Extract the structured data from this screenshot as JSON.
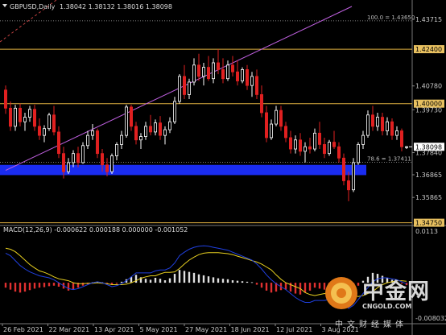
{
  "chart_data": [
    {
      "type": "candlestick",
      "symbol_header": "GBPUSD,Daily",
      "ohlc_header": "1.38042 1.38132 1.38016 1.38098",
      "ylim": [
        1.347,
        1.44
      ],
      "y_ticks": [
        1.43715,
        1.4224,
        1.4078,
        1.3973,
        1.3784,
        1.36865,
        1.35865,
        1.3475
      ],
      "y_tick_labels": [
        "1.43715",
        "1.42400",
        "1.40780",
        "1.39730",
        "1.37840",
        "1.36865",
        "1.35865",
        "1.34750"
      ],
      "x_labels": [
        "26 Feb 2021",
        "22 Mar 2021",
        "13 Apr 2021",
        "5 May 2021",
        "27 May 2021",
        "18 Jun 2021",
        "12 Jul 2021",
        "3 Aug 2021"
      ],
      "horizontal_levels": [
        {
          "value": 1.4365,
          "label": "100.0 = 1.43650",
          "style": "dotted",
          "color": "#aaaaaa"
        },
        {
          "value": 1.424,
          "label": "1.42400",
          "style": "solid",
          "color": "#e0b040"
        },
        {
          "value": 1.4,
          "label": "1.40000",
          "style": "solid",
          "color": "#e0b040"
        },
        {
          "value": 1.37411,
          "label": "78.6 = 1.37411",
          "style": "dotted",
          "color": "#aaaaaa"
        },
        {
          "value": 1.3475,
          "label": "1.34750",
          "style": "solid",
          "color": "#e0b040"
        }
      ],
      "current_price": {
        "value": 1.38098,
        "label": "1.38098"
      },
      "support_zone": {
        "low": 1.3685,
        "high": 1.373,
        "color": "#1a2cf0"
      },
      "candles": [
        [
          1.406,
          1.408,
          1.3955,
          1.398
        ],
        [
          1.398,
          1.401,
          1.388,
          1.39
        ],
        [
          1.39,
          1.3995,
          1.388,
          1.398
        ],
        [
          1.398,
          1.4,
          1.39,
          1.392
        ],
        [
          1.392,
          1.396,
          1.388,
          1.394
        ],
        [
          1.394,
          1.399,
          1.392,
          1.3975
        ],
        [
          1.3975,
          1.3995,
          1.388,
          1.39
        ],
        [
          1.39,
          1.3935,
          1.384,
          1.386
        ],
        [
          1.386,
          1.3905,
          1.383,
          1.389
        ],
        [
          1.389,
          1.396,
          1.388,
          1.395
        ],
        [
          1.395,
          1.399,
          1.386,
          1.3875
        ],
        [
          1.3875,
          1.39,
          1.376,
          1.378
        ],
        [
          1.378,
          1.381,
          1.367,
          1.37
        ],
        [
          1.37,
          1.376,
          1.369,
          1.374
        ],
        [
          1.374,
          1.3795,
          1.372,
          1.378
        ],
        [
          1.378,
          1.381,
          1.372,
          1.374
        ],
        [
          1.374,
          1.383,
          1.3735,
          1.3815
        ],
        [
          1.3815,
          1.388,
          1.38,
          1.386
        ],
        [
          1.386,
          1.391,
          1.384,
          1.388
        ],
        [
          1.388,
          1.389,
          1.376,
          1.378
        ],
        [
          1.378,
          1.38,
          1.37,
          1.373
        ],
        [
          1.373,
          1.376,
          1.368,
          1.37
        ],
        [
          1.37,
          1.378,
          1.369,
          1.377
        ],
        [
          1.377,
          1.383,
          1.375,
          1.382
        ],
        [
          1.382,
          1.388,
          1.38,
          1.386
        ],
        [
          1.386,
          1.3995,
          1.385,
          1.3985
        ],
        [
          1.3985,
          1.3995,
          1.388,
          1.39
        ],
        [
          1.39,
          1.392,
          1.382,
          1.384
        ],
        [
          1.384,
          1.387,
          1.38,
          1.3855
        ],
        [
          1.3855,
          1.392,
          1.384,
          1.39
        ],
        [
          1.39,
          1.395,
          1.386,
          1.3875
        ],
        [
          1.3875,
          1.393,
          1.386,
          1.3915
        ],
        [
          1.3915,
          1.3945,
          1.384,
          1.386
        ],
        [
          1.386,
          1.39,
          1.382,
          1.3885
        ],
        [
          1.3885,
          1.394,
          1.387,
          1.392
        ],
        [
          1.392,
          1.403,
          1.391,
          1.401
        ],
        [
          1.401,
          1.413,
          1.4,
          1.412
        ],
        [
          1.412,
          1.417,
          1.402,
          1.404
        ],
        [
          1.404,
          1.411,
          1.402,
          1.4095
        ],
        [
          1.4095,
          1.42,
          1.408,
          1.417
        ],
        [
          1.417,
          1.422,
          1.41,
          1.412
        ],
        [
          1.412,
          1.418,
          1.408,
          1.416
        ],
        [
          1.416,
          1.421,
          1.41,
          1.411
        ],
        [
          1.411,
          1.42,
          1.409,
          1.418
        ],
        [
          1.418,
          1.424,
          1.413,
          1.415
        ],
        [
          1.415,
          1.42,
          1.409,
          1.411
        ],
        [
          1.411,
          1.419,
          1.41,
          1.417
        ],
        [
          1.417,
          1.421,
          1.412,
          1.414
        ],
        [
          1.414,
          1.419,
          1.408,
          1.41
        ],
        [
          1.41,
          1.416,
          1.409,
          1.415
        ],
        [
          1.415,
          1.417,
          1.406,
          1.408
        ],
        [
          1.408,
          1.414,
          1.403,
          1.412
        ],
        [
          1.412,
          1.415,
          1.402,
          1.404
        ],
        [
          1.404,
          1.408,
          1.394,
          1.396
        ],
        [
          1.396,
          1.399,
          1.383,
          1.385
        ],
        [
          1.385,
          1.393,
          1.384,
          1.391
        ],
        [
          1.391,
          1.399,
          1.39,
          1.397
        ],
        [
          1.397,
          1.399,
          1.388,
          1.39
        ],
        [
          1.39,
          1.392,
          1.383,
          1.385
        ],
        [
          1.385,
          1.388,
          1.378,
          1.38
        ],
        [
          1.38,
          1.386,
          1.378,
          1.384
        ],
        [
          1.384,
          1.387,
          1.377,
          1.379
        ],
        [
          1.379,
          1.383,
          1.374,
          1.381
        ],
        [
          1.381,
          1.385,
          1.378,
          1.38
        ],
        [
          1.38,
          1.389,
          1.379,
          1.387
        ],
        [
          1.387,
          1.392,
          1.38,
          1.382
        ],
        [
          1.382,
          1.385,
          1.376,
          1.378
        ],
        [
          1.378,
          1.384,
          1.377,
          1.383
        ],
        [
          1.383,
          1.388,
          1.38,
          1.381
        ],
        [
          1.381,
          1.383,
          1.374,
          1.376
        ],
        [
          1.376,
          1.378,
          1.364,
          1.366
        ],
        [
          1.366,
          1.37,
          1.357,
          1.362
        ],
        [
          1.362,
          1.376,
          1.361,
          1.374
        ],
        [
          1.374,
          1.383,
          1.373,
          1.382
        ],
        [
          1.382,
          1.388,
          1.38,
          1.386
        ],
        [
          1.386,
          1.397,
          1.385,
          1.395
        ],
        [
          1.395,
          1.399,
          1.388,
          1.39
        ],
        [
          1.39,
          1.396,
          1.388,
          1.394
        ],
        [
          1.394,
          1.396,
          1.386,
          1.388
        ],
        [
          1.388,
          1.394,
          1.386,
          1.392
        ],
        [
          1.392,
          1.3935,
          1.384,
          1.386
        ],
        [
          1.386,
          1.39,
          1.384,
          1.388
        ],
        [
          1.388,
          1.389,
          1.379,
          1.381
        ],
        [
          1.381,
          1.3813,
          1.38,
          1.381
        ]
      ],
      "fib_line": {
        "from": [
          0,
          1.372
        ],
        "to": [
          60,
          1.44
        ],
        "color": "#c060e0"
      }
    },
    {
      "type": "macd",
      "header": "MACD(12,26,9) -0.000622 0.000188 0.000000 -0.001052",
      "ylim": [
        -0.008,
        0.0113
      ],
      "y_tick_labels": [
        "0.0113",
        "-0.008032"
      ],
      "histogram_colors": {
        "up": "#e0e0e0",
        "down": "#e03030"
      },
      "signal_color": "#e8d020",
      "line_color": "#2040e0",
      "histogram": [
        -0.001,
        -0.0014,
        -0.0018,
        -0.002,
        -0.0018,
        -0.0015,
        -0.0012,
        -0.001,
        -0.0009,
        -0.0007,
        -0.0006,
        -0.0008,
        -0.0012,
        -0.0016,
        -0.0014,
        -0.001,
        -0.0006,
        -0.0003,
        0.0001,
        0.0002,
        0.0001,
        -0.0002,
        -0.0004,
        -0.0002,
        0.0002,
        0.0007,
        0.0012,
        0.0016,
        0.0011,
        0.0008,
        0.0006,
        0.001,
        0.0008,
        0.0005,
        0.0009,
        0.0018,
        0.0026,
        0.0024,
        0.0022,
        0.002,
        0.0017,
        0.0015,
        0.0013,
        0.0011,
        0.0009,
        0.0008,
        0.0007,
        0.0005,
        0.0004,
        0.0003,
        0.0002,
        0.0001,
        -0.0004,
        -0.001,
        -0.0016,
        -0.002,
        -0.0018,
        -0.0015,
        -0.0014,
        -0.0018,
        -0.0022,
        -0.0024,
        -0.002,
        -0.0016,
        -0.001,
        -0.0012,
        -0.0014,
        -0.0011,
        -0.0008,
        -0.0006,
        -0.0018,
        -0.003,
        -0.002,
        -0.0006,
        0.0004,
        0.0012,
        0.002,
        0.0018,
        0.0014,
        0.001,
        0.0006,
        0.0002,
        -0.0002,
        -0.0005
      ],
      "macd_line": [
        0.006,
        0.0055,
        0.0045,
        0.0035,
        0.0028,
        0.0022,
        0.0018,
        0.0014,
        0.0012,
        0.001,
        0.0006,
        0.0,
        -0.0006,
        -0.0012,
        -0.0014,
        -0.0012,
        -0.0008,
        -0.0004,
        0.0,
        0.0002,
        0.0,
        -0.0004,
        -0.0008,
        -0.0006,
        -0.0002,
        0.0004,
        0.0012,
        0.002,
        0.002,
        0.002,
        0.002,
        0.0024,
        0.0026,
        0.0026,
        0.003,
        0.004,
        0.0055,
        0.0062,
        0.0068,
        0.0072,
        0.0074,
        0.0075,
        0.0074,
        0.0072,
        0.007,
        0.0068,
        0.0066,
        0.0062,
        0.0058,
        0.0054,
        0.005,
        0.0046,
        0.0038,
        0.0028,
        0.0016,
        0.0006,
        -0.0002,
        -0.0008,
        -0.0014,
        -0.0022,
        -0.003,
        -0.0036,
        -0.004,
        -0.004,
        -0.0036,
        -0.0036,
        -0.0036,
        -0.0034,
        -0.003,
        -0.0028,
        -0.0038,
        -0.0052,
        -0.0046,
        -0.0034,
        -0.0022,
        -0.001,
        0.0002,
        0.0008,
        0.001,
        0.001,
        0.0008,
        0.0006,
        0.0002,
        -0.0002
      ],
      "signal_line": [
        0.007,
        0.0068,
        0.0063,
        0.0055,
        0.0046,
        0.0037,
        0.003,
        0.0024,
        0.0021,
        0.0017,
        0.0012,
        0.0008,
        0.0006,
        0.0004,
        0.0,
        -0.0002,
        -0.0002,
        -0.0001,
        -0.0001,
        0.0,
        -0.0001,
        -0.0002,
        -0.0004,
        -0.0004,
        -0.0004,
        -0.0003,
        0.0,
        0.0004,
        0.0009,
        0.0012,
        0.0014,
        0.0014,
        0.0018,
        0.0021,
        0.0021,
        0.0022,
        0.0029,
        0.0038,
        0.0046,
        0.0052,
        0.0057,
        0.006,
        0.0061,
        0.0061,
        0.0061,
        0.006,
        0.0059,
        0.0057,
        0.0054,
        0.0051,
        0.0048,
        0.0045,
        0.0042,
        0.0038,
        0.0032,
        0.0026,
        0.0016,
        0.0007,
        0.0,
        -0.0004,
        -0.0008,
        -0.0012,
        -0.002,
        -0.0024,
        -0.0026,
        -0.0024,
        -0.0022,
        -0.0023,
        -0.0022,
        -0.0022,
        -0.002,
        -0.0022,
        -0.0026,
        -0.0028,
        -0.0026,
        -0.0022,
        -0.0018,
        -0.001,
        -0.0004,
        0.0,
        0.0002,
        0.0004,
        0.0004,
        0.0003
      ]
    }
  ],
  "watermark": {
    "logo_text": "中金网",
    "domain": "CNGOLD.COM",
    "tagline": "中文财经媒体"
  }
}
